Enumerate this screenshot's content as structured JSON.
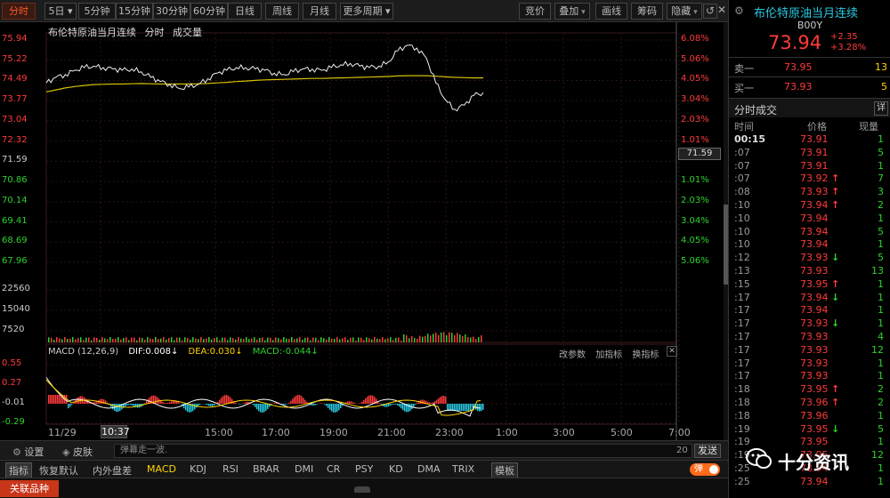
{
  "toolbar": {
    "periods": [
      "分时",
      "5日",
      "5分钟",
      "15分钟",
      "30分钟",
      "60分钟",
      "日线",
      "周线",
      "月线",
      "更多周期"
    ],
    "active_period": "分时",
    "tools": [
      "竞价",
      "叠加",
      "画线",
      "筹码",
      "隐藏"
    ],
    "window_controls": [
      "↺",
      "✕"
    ]
  },
  "chart_header": {
    "name": "布伦特原油当月连续",
    "mode": "分时",
    "sub": "成交量"
  },
  "price_tag": "71.59",
  "macd_header": {
    "name": "MACD (12,26,9)",
    "dif": "DIF:0.008↓",
    "dea": "DEA:0.030↓",
    "macd": "MACD:-0.044↓"
  },
  "macd_tools": [
    "改参数",
    "加指标",
    "换指标"
  ],
  "x_axis": {
    "start": "11/29",
    "highlight": "10:37",
    "labels": [
      "15:00",
      "17:00",
      "19:00",
      "21:00",
      "23:00",
      "1:00",
      "3:00",
      "5:00",
      "7:00"
    ]
  },
  "bottom": {
    "settings": "设置",
    "skin": "皮肤",
    "danmu_placeholder": "弹幕走一波.",
    "danmu_count": "20",
    "send": "发送",
    "indicator_label": "指标",
    "restore_default": "恢复默认",
    "inner_outer": "内外盘差",
    "indicators": [
      "MACD",
      "KDJ",
      "RSI",
      "BRAR",
      "DMI",
      "CR",
      "PSY",
      "KD",
      "DMA",
      "TRIX"
    ],
    "active_indicator": "MACD",
    "template": "模板",
    "danmu_toggle": "弹",
    "related": "关联品种"
  },
  "quote": {
    "title": "布伦特原油当月连续",
    "code": "B00Y",
    "price": "73.94",
    "change": "+2.35",
    "change_pct": "+3.28%",
    "sell_label": "卖一",
    "sell_price": "73.95",
    "sell_vol": "13",
    "buy_label": "买一",
    "buy_price": "73.93",
    "buy_vol": "5",
    "trades_title": "分时成交",
    "detail": "详",
    "col_time": "时间",
    "col_price": "价格",
    "col_vol": "现量"
  },
  "watermark": "十分资讯",
  "chart_data": {
    "type": "line",
    "title": "布伦特原油当月连续",
    "price_axis": [
      "75.94",
      "75.22",
      "74.49",
      "73.77",
      "73.04",
      "72.32",
      "71.59",
      "70.86",
      "70.14",
      "69.41",
      "68.69",
      "67.96"
    ],
    "pct_axis": [
      "6.08%",
      "5.06%",
      "4.05%",
      "3.04%",
      "2.03%",
      "1.01%",
      "0.00%",
      "1.01%",
      "2.03%",
      "3.04%",
      "4.05%",
      "5.06%"
    ],
    "volume_axis": [
      "22560",
      "15040",
      "7520"
    ],
    "macd_axis": [
      "0.55",
      "0.27",
      "-0.01",
      "-0.29"
    ],
    "ylim": [
      67.96,
      75.94
    ],
    "reference_close": 71.59,
    "x": [
      "10:37",
      "15:00",
      "17:00",
      "19:00",
      "21:00",
      "23:00",
      "1:00",
      "3:00",
      "5:00",
      "7:00"
    ],
    "series": [
      {
        "values": [
          74.4,
          74.6,
          74.7,
          74.85,
          74.95,
          75.0,
          74.95,
          74.9,
          74.85,
          74.9,
          74.8,
          74.6,
          74.45,
          74.35,
          74.2,
          74.25,
          74.35,
          74.55,
          74.75,
          74.85,
          74.95,
          74.95,
          74.9,
          74.85,
          74.75,
          74.7,
          74.8,
          74.9,
          74.9,
          74.85,
          74.95,
          75.05,
          75.1,
          75.0,
          74.95,
          75.0,
          75.15,
          75.55,
          75.75,
          75.65,
          75.3,
          74.4,
          73.8,
          73.45,
          73.6,
          73.95,
          74.05
        ]
      },
      {
        "values": [
          74.08,
          74.15,
          74.22,
          74.27,
          74.31,
          74.34,
          74.35,
          74.36,
          74.36,
          74.37,
          74.38,
          74.37,
          74.36,
          74.36,
          74.36,
          74.36,
          74.37,
          74.38,
          74.4,
          74.42,
          74.45,
          74.47,
          74.49,
          74.51,
          74.52,
          74.53,
          74.54,
          74.55,
          74.56,
          74.56,
          74.57,
          74.58,
          74.59,
          74.6,
          74.61,
          74.62,
          74.63,
          74.65,
          74.66,
          74.66,
          74.66,
          74.64,
          74.62,
          74.6,
          74.59,
          74.58,
          74.58
        ]
      }
    ]
  },
  "trades": [
    {
      "t": "00:15",
      "p": "73.91",
      "d": "",
      "v": "1"
    },
    {
      "t": ":07",
      "p": "73.91",
      "d": "",
      "v": "5"
    },
    {
      "t": ":07",
      "p": "73.91",
      "d": "",
      "v": "1"
    },
    {
      "t": ":07",
      "p": "73.92",
      "d": "up",
      "v": "7"
    },
    {
      "t": ":08",
      "p": "73.93",
      "d": "up",
      "v": "3"
    },
    {
      "t": ":10",
      "p": "73.94",
      "d": "up",
      "v": "2"
    },
    {
      "t": ":10",
      "p": "73.94",
      "d": "",
      "v": "1"
    },
    {
      "t": ":10",
      "p": "73.94",
      "d": "",
      "v": "5"
    },
    {
      "t": ":10",
      "p": "73.94",
      "d": "",
      "v": "1"
    },
    {
      "t": ":12",
      "p": "73.93",
      "d": "down",
      "v": "5"
    },
    {
      "t": ":13",
      "p": "73.93",
      "d": "",
      "v": "13"
    },
    {
      "t": ":15",
      "p": "73.95",
      "d": "up",
      "v": "1"
    },
    {
      "t": ":17",
      "p": "73.94",
      "d": "down",
      "v": "1"
    },
    {
      "t": ":17",
      "p": "73.94",
      "d": "",
      "v": "1"
    },
    {
      "t": ":17",
      "p": "73.93",
      "d": "down",
      "v": "1"
    },
    {
      "t": ":17",
      "p": "73.93",
      "d": "",
      "v": "4"
    },
    {
      "t": ":17",
      "p": "73.93",
      "d": "",
      "v": "12"
    },
    {
      "t": ":17",
      "p": "73.93",
      "d": "",
      "v": "1"
    },
    {
      "t": ":17",
      "p": "73.93",
      "d": "",
      "v": "1"
    },
    {
      "t": ":18",
      "p": "73.95",
      "d": "up",
      "v": "2"
    },
    {
      "t": ":18",
      "p": "73.96",
      "d": "up",
      "v": "2"
    },
    {
      "t": ":18",
      "p": "73.96",
      "d": "",
      "v": "1"
    },
    {
      "t": ":19",
      "p": "73.95",
      "d": "down",
      "v": "5"
    },
    {
      "t": ":19",
      "p": "73.95",
      "d": "",
      "v": "1"
    },
    {
      "t": ":19",
      "p": "73.95",
      "d": "",
      "v": "12"
    },
    {
      "t": ":25",
      "p": "73.94",
      "d": "",
      "v": "1"
    },
    {
      "t": ":25",
      "p": "73.94",
      "d": "",
      "v": "1"
    }
  ]
}
